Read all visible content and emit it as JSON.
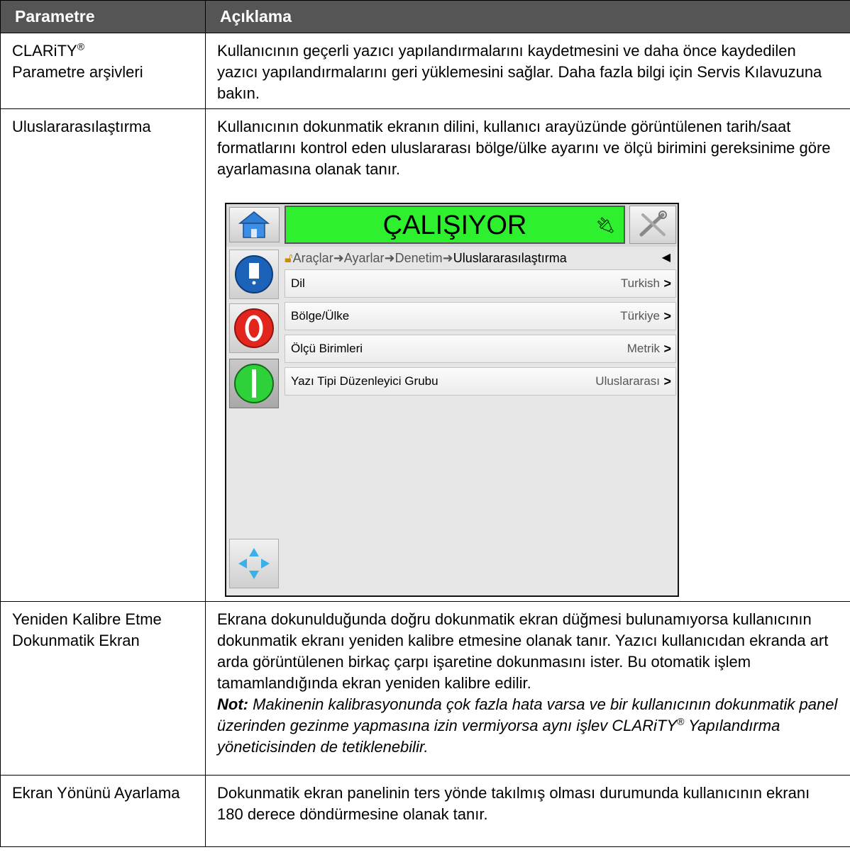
{
  "table": {
    "headers": [
      "Parametre",
      "Açıklama"
    ],
    "rows": [
      {
        "param_line1": "CLARiTY",
        "param_sup": "®",
        "param_line2": "Parametre arşivleri",
        "desc": "Kullanıcının geçerli yazıcı yapılandırmalarını kaydetmesini ve daha önce kaydedilen yazıcı yapılandırmalarını geri yüklemesini sağlar. Daha fazla bilgi için Servis Kılavuzuna bakın."
      },
      {
        "param": "Uluslararasılaştırma",
        "desc": "Kullanıcının dokunmatik ekranın dilini, kullanıcı arayüzünde görüntülenen tarih/saat formatlarını kontrol eden uluslararası bölge/ülke ayarını ve ölçü birimini gereksinime göre ayarlamasına olanak tanır."
      },
      {
        "param": "Yeniden Kalibre Etme Dokunmatik Ekran",
        "desc": "Ekrana dokunulduğunda doğru dokunmatik ekran düğmesi bulunamıyorsa kullanıcının dokunmatik ekranı yeniden kalibre etmesine olanak tanır. Yazıcı kullanıcıdan ekranda art arda görüntülenen birkaç çarpı işaretine dokunmasını ister. Bu otomatik işlem tamamlandığında ekran yeniden kalibre edilir.",
        "note_label": "Not:",
        "note_text": " Makinenin kalibrasyonunda çok fazla hata varsa ve bir kullanıcının dokunmatik panel üzerinden gezinme yapmasına izin vermiyorsa aynı işlev CLARiTY",
        "note_sup": "®",
        "note_tail": " Yapılandırma yöneticisinden de tetiklenebilir."
      },
      {
        "param": "Ekran Yönünü Ayarlama",
        "desc": "Dokunmatik ekran panelinin ters yönde takılmış olması durumunda kullanıcının ekranı 180 derece döndürmesine olanak tanır."
      }
    ]
  },
  "device": {
    "status": "ÇALIŞIYOR",
    "status_color": "#2ff02f",
    "breadcrumb": [
      "Araçlar",
      "Ayarlar",
      "Denetim"
    ],
    "breadcrumb_current": "Uluslararasılaştırma",
    "breadcrumb_sep": "➜",
    "settings": [
      {
        "label": "Dil",
        "value": "Turkish"
      },
      {
        "label": "Bölge/Ülke",
        "value": "Türkiye"
      },
      {
        "label": "Ölçü Birimleri",
        "value": "Metrik"
      },
      {
        "label": "Yazı Tipi Düzenleyici Grubu",
        "value": "Uluslararası"
      }
    ],
    "icons": [
      "home-icon",
      "tools-icon",
      "plug-icon",
      "job-info-icon",
      "stop-icon",
      "start-icon",
      "navigation-icon",
      "lock-icon",
      "back-icon"
    ]
  }
}
